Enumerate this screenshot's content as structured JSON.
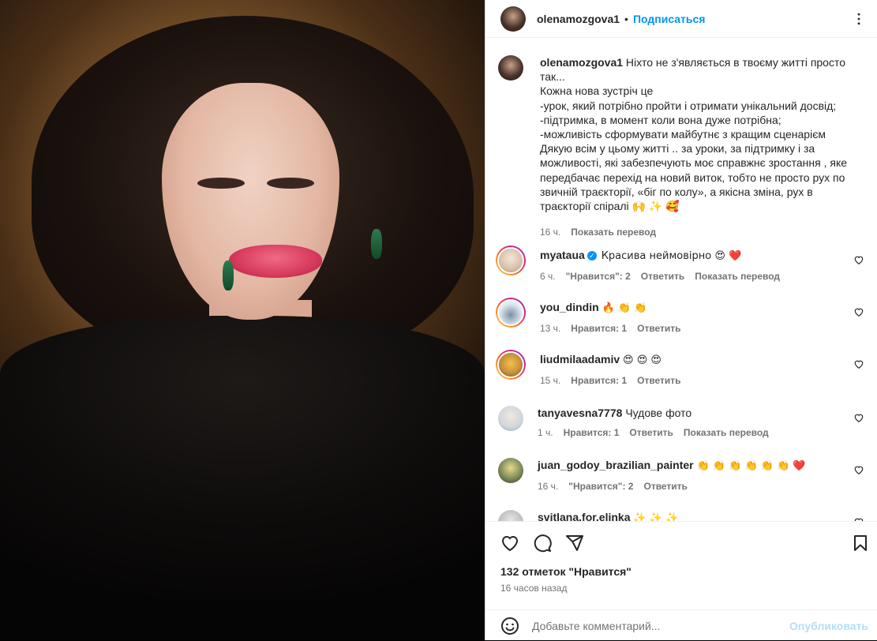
{
  "post": {
    "username": "olenamozgova1",
    "dot": "•",
    "follow_label": "Подписаться"
  },
  "caption": {
    "username": "olenamozgova1",
    "lines": [
      "Ніхто не з'являється в твоєму житті просто",
      "так...",
      "Кожна нова зустріч це",
      "-урок, який потрібно пройти і отримати унікальний досвід;",
      "-підтримка, в момент коли вона дуже потрібна;",
      "-можливість сформувати майбутнє з кращим сценарієм",
      "Дякую всім у цьому житті .. за уроки, за підтримку і за",
      "можливості, які забезпечують моє справжнє зростання , яке",
      "передбачає перехід на новий виток, тобто не просто рух по",
      "звичній траєкторії, «біг по колу», а якісна зміна, рух в",
      "траєкторії спіралі 🙌 ✨ 🥰"
    ],
    "time": "16 ч.",
    "translate": "Показать перевод"
  },
  "comments": [
    {
      "username": "myataua",
      "verified": true,
      "text": "Красива неймовірно 😍 ❤️",
      "time": "6 ч.",
      "likes": "\"Нравится\": 2",
      "reply": "Ответить",
      "translate": "Показать перевод",
      "ring": true
    },
    {
      "username": "you_dindin",
      "verified": false,
      "text": "🔥 👏 👏",
      "time": "13 ч.",
      "likes": "Нравится: 1",
      "reply": "Ответить",
      "translate": "",
      "ring": true
    },
    {
      "username": "liudmilaadamiv",
      "verified": false,
      "text": "😍 😍 😍",
      "time": "15 ч.",
      "likes": "Нравится: 1",
      "reply": "Ответить",
      "translate": "",
      "ring": true
    },
    {
      "username": "tanyavesna7778",
      "verified": false,
      "text": "Чудове фото",
      "time": "1 ч.",
      "likes": "Нравится: 1",
      "reply": "Ответить",
      "translate": "Показать перевод",
      "ring": false
    },
    {
      "username": "juan_godoy_brazilian_painter",
      "verified": false,
      "text": "👏 👏 👏 👏 👏 👏 ❤️",
      "time": "16 ч.",
      "likes": "\"Нравится\": 2",
      "reply": "Ответить",
      "translate": "",
      "ring": false
    },
    {
      "username": "svitlana.for.elinka",
      "verified": false,
      "text": "✨ ✨ ✨",
      "time": "",
      "likes": "",
      "reply": "",
      "translate": "",
      "ring": false
    }
  ],
  "footer": {
    "likes": "132 отметок \"Нравится\"",
    "time": "16 часов назад",
    "comment_placeholder": "Добавьте комментарий...",
    "post_label": "Опубликовать"
  },
  "icons": {
    "like": "heart-icon",
    "comment": "comment-icon",
    "share": "send-icon",
    "save": "bookmark-icon",
    "emoji": "emoji-icon",
    "more": "more-icon"
  },
  "colors": {
    "accent": "#0095f6",
    "post_disabled": "#b2dffc",
    "secondary_text": "#737373"
  }
}
